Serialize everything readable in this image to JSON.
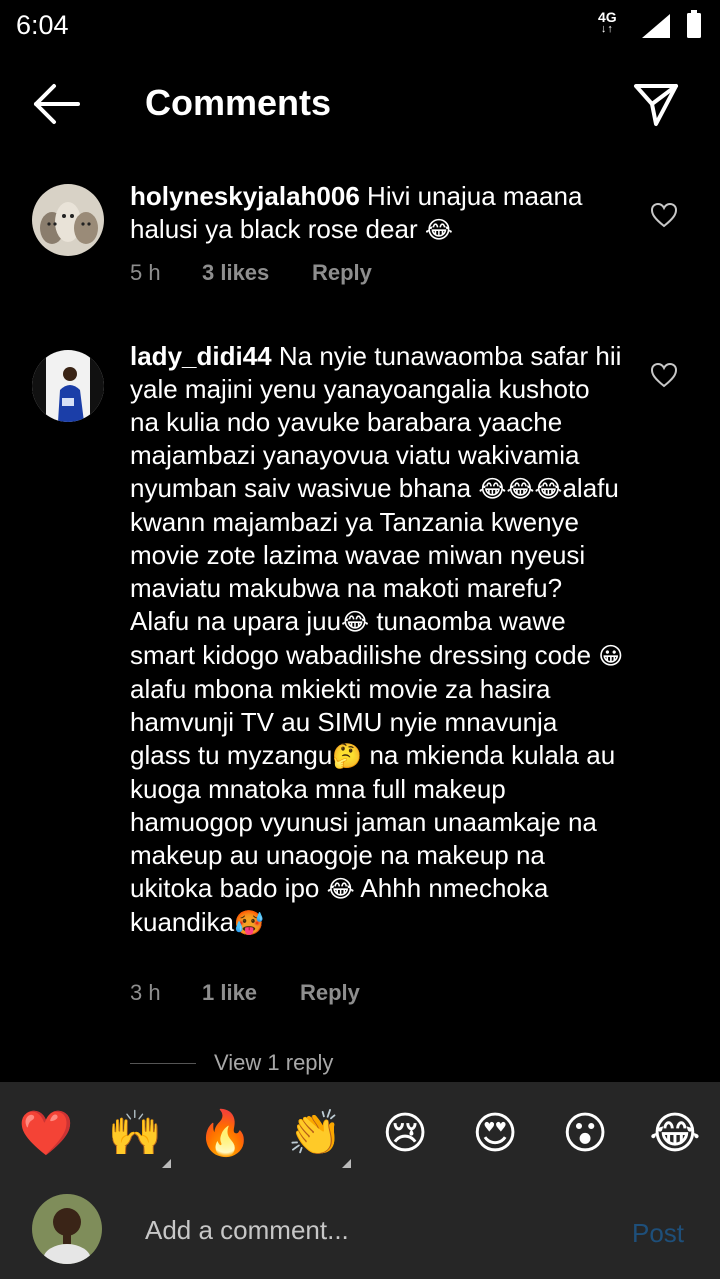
{
  "status_bar": {
    "time": "6:04",
    "network": "4G",
    "network_arrows": "↓↑"
  },
  "header": {
    "title": "Comments"
  },
  "comments": [
    {
      "username": "holyneskyjalah006",
      "text": "Hivi unajua maana halusi ya black rose dear",
      "emoji_end": "😂",
      "time": "5 h",
      "likes": "3 likes",
      "reply": "Reply"
    },
    {
      "username": "lady_didi44",
      "segments": [
        "Na nyie tunawaomba safar hii yale majini yenu yanayoangalia kushoto na kulia ndo yavuke barabara yaache  majambazi yanayovua viatu wakivamia nyumban saiv wasivue bhana ",
        "😂😂😂",
        "alafu kwann majambazi ya Tanzania kwenye movie zote lazima wavae miwan nyeusi maviatu makubwa na makoti marefu? Alafu na upara juu",
        "😂",
        " tunaomba wawe smart kidogo wabadilishe dressing code ",
        "😀",
        " alafu mbona mkiekti movie za hasira hamvunji TV au SIMU nyie mnavunja glass tu myzangu",
        "🤔",
        " na mkienda kulala au kuoga mnatoka mna full makeup hamuogop vyunusi jaman unaamkaje na makeup au unaogoje na makeup na ukitoka bado ipo ",
        "😂",
        " Ahhh nmechoka kuandika",
        "🥵"
      ],
      "time": "3 h",
      "likes": "1 like",
      "reply": "Reply",
      "view_replies": "View 1 reply"
    }
  ],
  "emoji_bar": [
    {
      "name": "heart",
      "glyph": "❤️"
    },
    {
      "name": "raised-hands",
      "glyph": "🙌"
    },
    {
      "name": "fire",
      "glyph": "🔥"
    },
    {
      "name": "clap",
      "glyph": "👏"
    },
    {
      "name": "crying",
      "glyph": "😢"
    },
    {
      "name": "heart-eyes",
      "glyph": "😍"
    },
    {
      "name": "surprised",
      "glyph": "😮"
    },
    {
      "name": "laughing",
      "glyph": "😂"
    }
  ],
  "composer": {
    "placeholder": "Add a comment...",
    "post_label": "Post"
  },
  "colors": {
    "background": "#000000",
    "panel": "#262626",
    "meta_text": "#8e8e8e",
    "post_disabled": "#1e4f7a"
  },
  "icons": {
    "back": "arrow-left-icon",
    "send": "paper-plane-icon",
    "like": "heart-outline-icon"
  }
}
